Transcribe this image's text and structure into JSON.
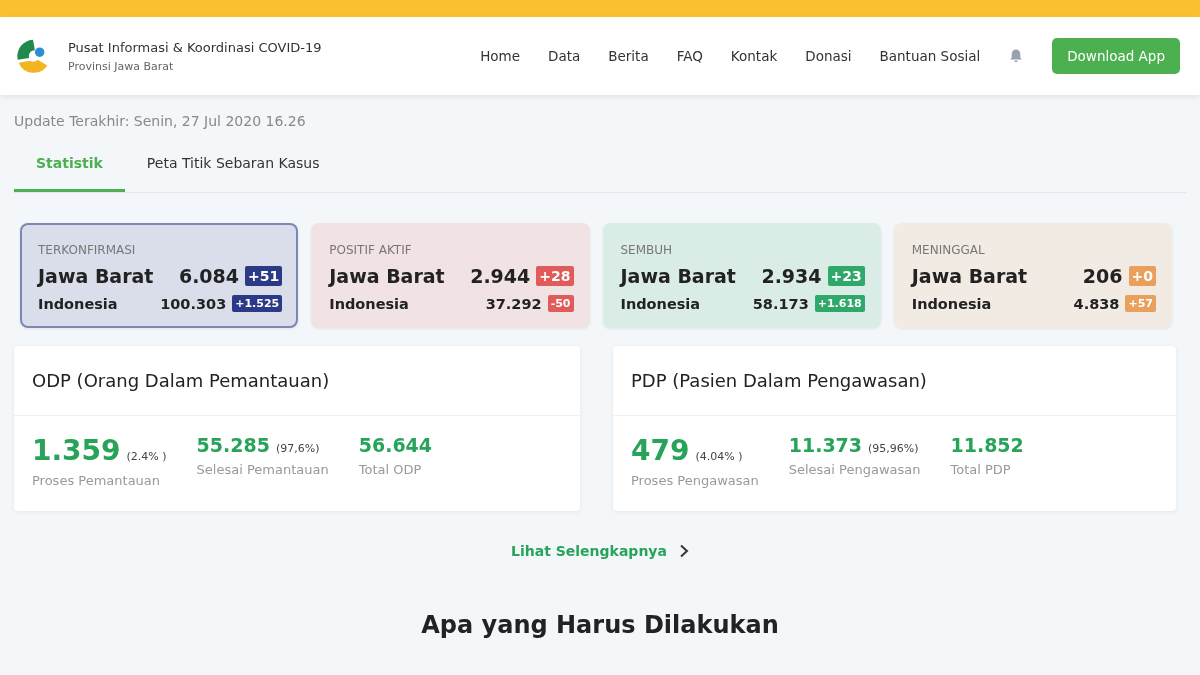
{
  "header": {
    "title": "Pusat Informasi & Koordinasi COVID-19",
    "subtitle": "Provinsi Jawa Barat"
  },
  "nav": [
    "Home",
    "Data",
    "Berita",
    "FAQ",
    "Kontak",
    "Donasi",
    "Bantuan Sosial"
  ],
  "download_button": "Download App",
  "update_text": "Update Terakhir: Senin, 27 Jul 2020 16.26",
  "tabs": [
    {
      "label": "Statistik",
      "selected": true
    },
    {
      "label": "Peta Titik Sebaran Kasus",
      "selected": false
    }
  ],
  "cards": [
    {
      "label": "TERKONFIRMASI",
      "selected": true,
      "color": "#2b3a87",
      "rows": [
        {
          "name": "Jawa Barat",
          "value": "6.084",
          "delta": "+51"
        },
        {
          "name": "Indonesia",
          "value": "100.303",
          "delta": "+1.525"
        }
      ]
    },
    {
      "label": "POSITIF AKTIF",
      "selected": false,
      "color": "#e25b5b",
      "rows": [
        {
          "name": "Jawa Barat",
          "value": "2.944",
          "delta": "+28"
        },
        {
          "name": "Indonesia",
          "value": "37.292",
          "delta": "-50"
        }
      ]
    },
    {
      "label": "SEMBUH",
      "selected": false,
      "color": "#2fa86a",
      "rows": [
        {
          "name": "Jawa Barat",
          "value": "2.934",
          "delta": "+23"
        },
        {
          "name": "Indonesia",
          "value": "58.173",
          "delta": "+1.618"
        }
      ]
    },
    {
      "label": "MENINGGAL",
      "selected": false,
      "color": "#e8a05c",
      "rows": [
        {
          "name": "Jawa Barat",
          "value": "206",
          "delta": "+0"
        },
        {
          "name": "Indonesia",
          "value": "4.838",
          "delta": "+57"
        }
      ]
    }
  ],
  "panels": [
    {
      "title": "ODP (Orang Dalam Pemantauan)",
      "stats": [
        {
          "value": "1.359",
          "percent": "(2.4% )",
          "caption": "Proses Pemantauan",
          "kind": "main"
        },
        {
          "value": "55.285",
          "percent": "(97,6%)",
          "caption": "Selesai Pemantauan",
          "kind": "sub"
        },
        {
          "value": "56.644",
          "caption": "Total ODP",
          "kind": "sub"
        }
      ]
    },
    {
      "title": "PDP (Pasien Dalam Pengawasan)",
      "stats": [
        {
          "value": "479",
          "percent": "(4.04% )",
          "caption": "Proses Pengawasan",
          "kind": "main"
        },
        {
          "value": "11.373",
          "percent": "(95,96%)",
          "caption": "Selesai Pengawasan",
          "kind": "sub"
        },
        {
          "value": "11.852",
          "caption": "Total PDP",
          "kind": "sub"
        }
      ]
    }
  ],
  "more_link": "Lihat Selengkapnya",
  "section_heading": "Apa yang Harus Dilakukan"
}
